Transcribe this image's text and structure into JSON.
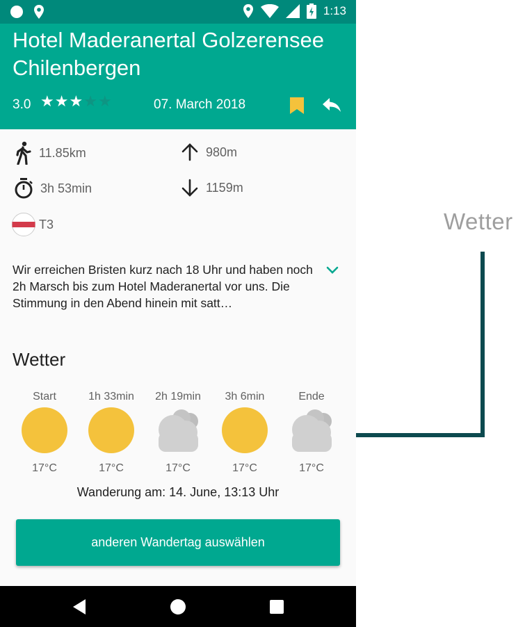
{
  "status_bar": {
    "time": "1:13",
    "icons": [
      "circle-icon",
      "location-icon",
      "location-icon",
      "wifi-icon",
      "signal-icon",
      "battery-icon"
    ]
  },
  "header": {
    "title": "Hotel Maderanertal Golzerensee Chilenbergen",
    "rating_value": "3.0",
    "rating": 3,
    "rating_max": 5,
    "date": "07. March 2018",
    "bookmark_color": "#f4c23c"
  },
  "stats": {
    "distance": "11.85km",
    "ascent": "980m",
    "duration": "3h 53min",
    "descent": "1159m",
    "difficulty": "T3"
  },
  "description": "Wir erreichen Bristen kurz nach 18 Uhr und haben noch 2h Marsch bis zum Hotel Maderanertal vor uns. Die Stimmung in den Abend hinein mit satt…",
  "weather": {
    "title": "Wetter",
    "forecast": [
      {
        "time": "Start",
        "icon": "sun-icon",
        "temp": "17°C"
      },
      {
        "time": "1h 33min",
        "icon": "sun-icon",
        "temp": "17°C"
      },
      {
        "time": "2h 19min",
        "icon": "cloud-icon",
        "temp": "17°C"
      },
      {
        "time": "3h 6min",
        "icon": "sun-icon",
        "temp": "17°C"
      },
      {
        "time": "Ende",
        "icon": "cloud-icon",
        "temp": "17°C"
      }
    ],
    "hike_date": "Wanderung am: 14. June, 13:13 Uhr",
    "button_label": "anderen Wandertag auswählen"
  },
  "side_label": "Wetter",
  "colors": {
    "primary": "#00a890",
    "primary_dark": "#00897b",
    "sun": "#f4c23c",
    "cloud": "#d0d0d0",
    "connector": "#0d4a4f"
  }
}
